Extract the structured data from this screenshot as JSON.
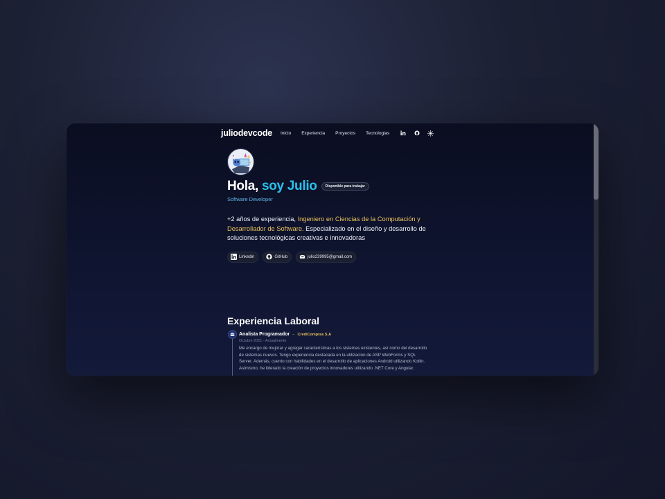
{
  "nav": {
    "logo": "juliodevcode",
    "links": [
      "Inicio",
      "Experiencia",
      "Proyectos",
      "Tecnologias"
    ],
    "icons": [
      "linkedin-icon",
      "github-icon",
      "sun-icon"
    ]
  },
  "hero": {
    "greeting": "Hola,",
    "name": "soy Julio",
    "badge": "Disponible para trabajar",
    "role": "Software Developer",
    "bio_part1": "+2 años de experiencia, ",
    "bio_highlight": "Ingeniero en Ciencias de la Computación y Desarrollador de Software.",
    "bio_part2": " Especializado en el diseño y desarrollo de soluciones tecnológicas creativas e innovadoras",
    "social": [
      {
        "label": "Linkedin",
        "icon": "linkedin-icon"
      },
      {
        "label": "GitHub",
        "icon": "github-icon"
      },
      {
        "label": "julio239995@gmail.com",
        "icon": "mail-icon"
      }
    ]
  },
  "experience": {
    "title": "Experiencia Laboral",
    "jobs": [
      {
        "title": "Analista Programador",
        "company": "CrediCompras S.A",
        "date": "Octubre 2021 - Actualmente",
        "description": "Me encargo de mejorar y agregar características a los sistemas existentes, así como del desarrollo de sistemas nuevos. Tengo experiencia destacada en la utilización de ASP WebForms y SQL Server. Además, cuento con habilidades en el desarrollo de aplicaciones Android utilizando Kotlin. Asimismo, he liderado la creación de proyectos innovadores utilizando .NET Core y Angular."
      }
    ]
  },
  "colors": {
    "accent": "#2bc0ec",
    "highlight": "#e7c15e",
    "background": "#0b0e20"
  }
}
